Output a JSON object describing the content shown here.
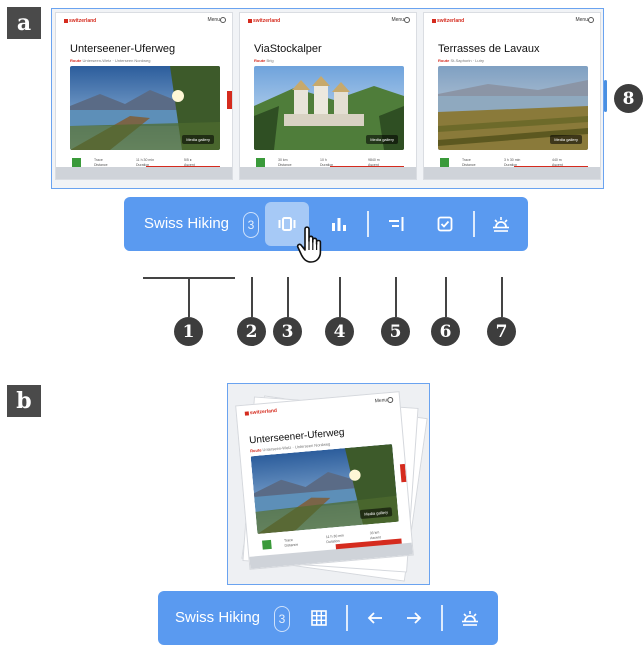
{
  "panels": {
    "a": "a",
    "b": "b"
  },
  "cards": [
    {
      "brand": "switzerland",
      "menu": "Menu",
      "title": "Unterseener-Uferweg",
      "sub_label": "Route",
      "sub_text": "Unterseen-Wetz · Unterseen Nordweg",
      "photo_button": "Media gallery",
      "stats": [
        "Trace",
        "11 h 30 min",
        "5/5 ♦",
        "Distance",
        "Duration",
        "Ascent"
      ],
      "theme": "lake"
    },
    {
      "brand": "switzerland",
      "menu": "Menu",
      "title": "ViaStockalper",
      "sub_label": "Route",
      "sub_text": "Brig",
      "photo_button": "Media gallery",
      "stats": [
        "30 km",
        "10 h",
        "9840 m",
        "Distance",
        "Duration",
        "Ascent"
      ],
      "theme": "castle"
    },
    {
      "brand": "switzerland",
      "menu": "Menu",
      "title": "Terrasses de Lavaux",
      "sub_label": "Route",
      "sub_text": "St-Saphorin · Lutry",
      "photo_button": "Media gallery",
      "stats": [
        "Trace",
        "3 h 30 min",
        "440 m",
        "Distance",
        "Duration",
        "Ascent"
      ],
      "theme": "vineyard"
    }
  ],
  "toolbar_a": {
    "title": "Swiss Hiking",
    "count": "3",
    "buttons": [
      {
        "name": "carousel-view-icon",
        "label": "carousel view",
        "active": true
      },
      {
        "name": "bar-chart-icon",
        "label": "compare"
      },
      {
        "name": "align-right-icon",
        "label": "align"
      },
      {
        "name": "checkbox-icon",
        "label": "select"
      },
      {
        "name": "weather-icon",
        "label": "weather"
      }
    ]
  },
  "callouts": [
    "1",
    "2",
    "3",
    "4",
    "5",
    "6",
    "7",
    "8"
  ],
  "stack_card": {
    "brand": "switzerland",
    "menu": "Menu",
    "title": "Unterseener-Uferweg",
    "sub_label": "Route",
    "sub_text": "Unterseen-Wetz · Unterseen Nordweg",
    "photo_button": "Media gallery",
    "stats": [
      "Trace",
      "11 h 30 min",
      "33 km",
      "Distance",
      "Duration",
      "Ascent"
    ]
  },
  "toolbar_b": {
    "title": "Swiss Hiking",
    "count": "3",
    "buttons": [
      {
        "name": "grid-view-icon",
        "label": "grid view"
      },
      {
        "name": "arrow-left-icon",
        "label": "previous"
      },
      {
        "name": "arrow-right-icon",
        "label": "next"
      },
      {
        "name": "weather-icon",
        "label": "weather"
      }
    ]
  },
  "colors": {
    "accent": "#5a9af0",
    "brand_red": "#d52b1e",
    "callout": "#3d3d3d",
    "frame": "#6aa3f0"
  }
}
